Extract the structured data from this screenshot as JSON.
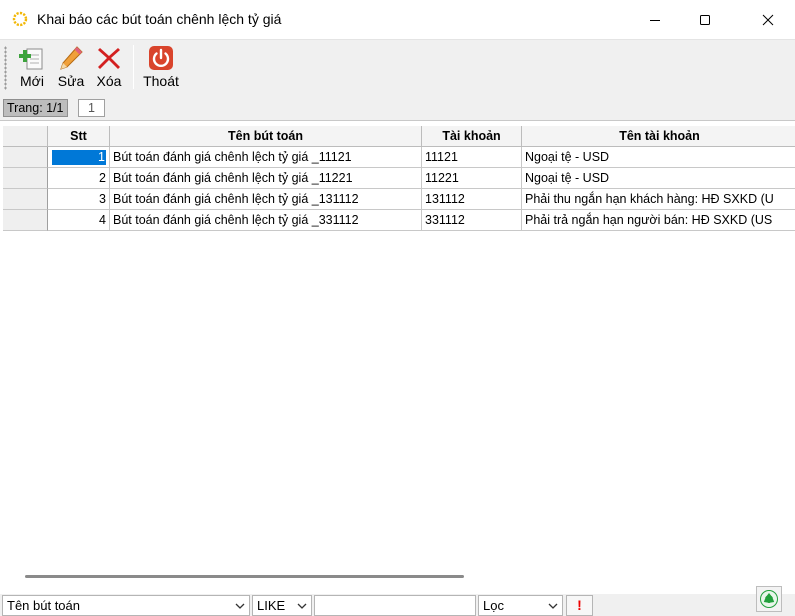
{
  "window": {
    "title": "Khai báo các bút toán chênh lệch tỷ giá"
  },
  "toolbar": {
    "new_label": "Mới",
    "edit_label": "Sửa",
    "delete_label": "Xóa",
    "exit_label": "Thoát"
  },
  "pager": {
    "label": "Trang: 1/1",
    "current_page": "1"
  },
  "grid": {
    "columns": {
      "stt": "Stt",
      "name": "Tên bút toán",
      "account": "Tài khoản",
      "account_name": "Tên tài khoản"
    },
    "rows": [
      {
        "stt": "1",
        "name": "Bút toán đánh giá chênh lệch tỷ giá _11121",
        "account": "11121",
        "account_name": "Ngoại tệ - USD"
      },
      {
        "stt": "2",
        "name": "Bút toán đánh giá chênh lệch tỷ giá _11221",
        "account": "11221",
        "account_name": "Ngoại tệ - USD"
      },
      {
        "stt": "3",
        "name": "Bút toán đánh giá chênh lệch tỷ giá _131112",
        "account": "131112",
        "account_name": "Phải thu ngắn hạn khách hàng: HĐ SXKD (U"
      },
      {
        "stt": "4",
        "name": "Bút toán đánh giá chênh lệch tỷ giá _331112",
        "account": "331112",
        "account_name": "Phải trả ngắn hạn người bán: HĐ SXKD (US"
      }
    ],
    "selected_row": 0
  },
  "filter": {
    "field": "Tên bút toán",
    "operator": "LIKE",
    "value": "",
    "action": "Lọc",
    "warn_label": "!"
  },
  "colors": {
    "selection": "#0078d7",
    "delete_red": "#d32020",
    "exit_red": "#d9442c",
    "refresh_green": "#22a03c"
  },
  "icons": {
    "app": "sun-icon",
    "new": "document-add-icon",
    "edit": "pencil-icon",
    "delete": "red-x-icon",
    "exit": "power-icon",
    "refresh": "recycle-icon"
  }
}
